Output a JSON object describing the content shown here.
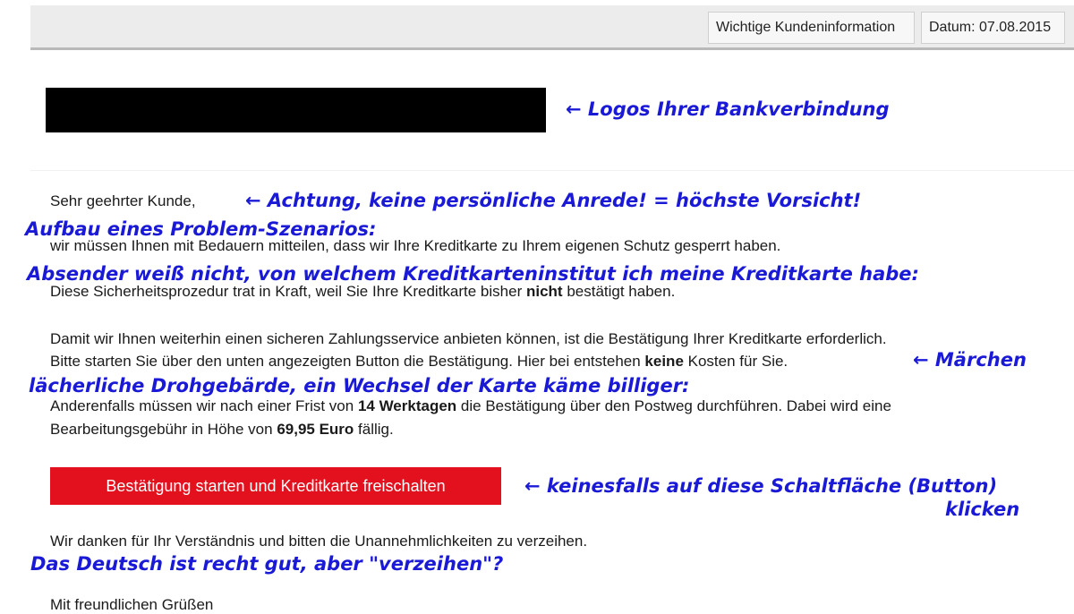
{
  "header": {
    "info_label": "Wichtige Kundeninformation",
    "date_label": "Datum: 07.08.2015"
  },
  "annotations": {
    "logos": "← Logos Ihrer Bankverbindung",
    "anrede": "← Achtung, keine persönliche Anrede! = höchste Vorsicht!",
    "szenario": "Aufbau eines Problem-Szenarios:",
    "absender": "Absender weiß nicht, von welchem Kreditkarteninstitut ich meine Kreditkarte habe:",
    "maerchen": "← Märchen",
    "drohung": "lächerliche Drohgebärde, ein Wechsel der Karte käme billiger:",
    "button_line1": "← keinesfalls auf diese Schaltfläche (Button)",
    "button_line2": "klicken",
    "deutsch": "Das Deutsch ist recht gut, aber \"verzeihen\"?"
  },
  "email": {
    "greeting": "Sehr geehrter Kunde,",
    "line_gesperrt": "wir müssen Ihnen mit Bedauern mitteilen, dass wir Ihre Kreditkarte zu Ihrem eigenen Schutz gesperrt haben.",
    "line_proz_a": "Diese Sicherheitsprozedur trat in Kraft, weil Sie Ihre Kreditkarte bisher",
    "line_proz_b": "nicht",
    "line_proz_c": "bestätigt haben.",
    "line_service": "Damit wir Ihnen weiterhin einen sicheren Zahlungsservice anbieten können, ist die Bestätigung Ihrer Kreditkarte erforderlich.",
    "line_button_a": "Bitte starten Sie über den unten angezeigten Button die Bestätigung. Hier bei entstehen",
    "line_button_b": "keine",
    "line_button_c": "Kosten für Sie.",
    "line_frist_a": "Anderenfalls müssen wir nach einer Frist von",
    "line_frist_b": "14 Werktagen",
    "line_frist_c": "die Bestätigung über den Postweg durchführen. Dabei wird eine",
    "line_gebuehr_a": "Bearbeitungsgebühr in Höhe von",
    "line_gebuehr_b": "69,95 Euro",
    "line_gebuehr_c": "fällig.",
    "cta_label": "Bestätigung starten und Kreditkarte freischalten",
    "line_dank": "Wir danken für Ihr Verständnis und bitten die Unannehmlichkeiten zu verzeihen.",
    "closing": "Mit freundlichen Grüßen"
  },
  "colors": {
    "annotation": "#1a1ad6",
    "cta_background": "#e3101d",
    "logo_redaction": "#000000"
  }
}
